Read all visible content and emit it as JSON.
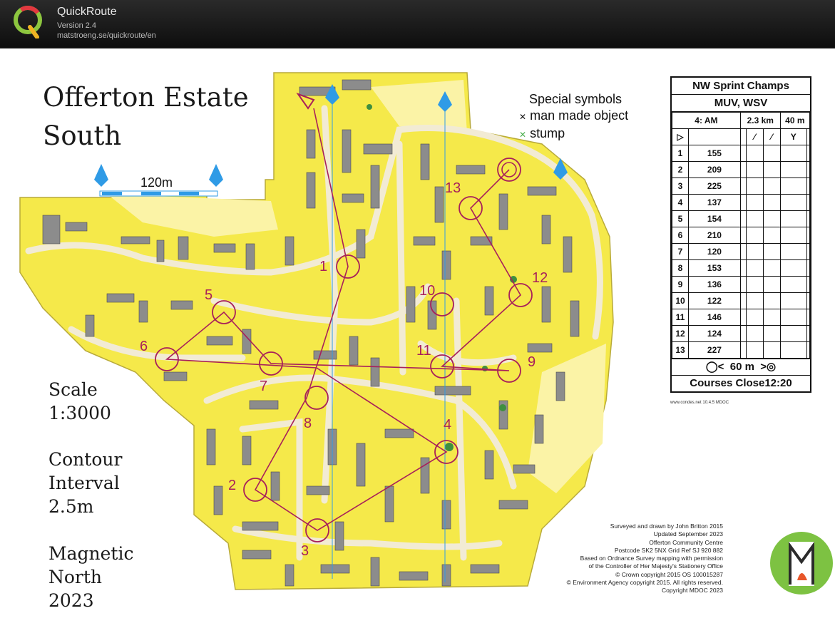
{
  "app": {
    "name": "QuickRoute",
    "version": "Version 2.4",
    "url": "matstroeng.se/quickroute/en"
  },
  "map": {
    "title_lines": [
      "Offerton Estate",
      "South"
    ],
    "scale_bar_label": "120m",
    "scale": [
      "Scale",
      "1:3000"
    ],
    "contour": [
      "Contour",
      "Interval",
      "2.5m"
    ],
    "magnetic": [
      "Magnetic",
      "North",
      "2023"
    ],
    "special_symbols": {
      "heading": "Special symbols",
      "items": [
        "man made object",
        "stump"
      ]
    },
    "control_numbers": [
      "1",
      "2",
      "3",
      "4",
      "5",
      "6",
      "7",
      "8",
      "9",
      "10",
      "11",
      "12",
      "13"
    ],
    "credits": [
      "Surveyed and drawn by John Britton 2015",
      "Updated September 2023",
      "Offerton Community Centre",
      "Postcode SK2 5NX   Grid Ref SJ 920 882",
      "Based on Ordnance Survey mapping with permission",
      "of the Controller of Her Majesty's Stationery Office",
      "© Crown copyright 2015 OS 100015287",
      "© Environment Agency copyright 2015. All rights reserved.",
      "Copyright MDOC 2023"
    ]
  },
  "control_description": {
    "event": "NW Sprint Champs",
    "classes": "MUV, WSV",
    "course": "4: AM",
    "length": "2.3 km",
    "climb": "40 m",
    "controls": [
      {
        "n": "1",
        "code": "155"
      },
      {
        "n": "2",
        "code": "209"
      },
      {
        "n": "3",
        "code": "225"
      },
      {
        "n": "4",
        "code": "137"
      },
      {
        "n": "5",
        "code": "154"
      },
      {
        "n": "6",
        "code": "210"
      },
      {
        "n": "7",
        "code": "120"
      },
      {
        "n": "8",
        "code": "153"
      },
      {
        "n": "9",
        "code": "136"
      },
      {
        "n": "10",
        "code": "122"
      },
      {
        "n": "11",
        "code": "146"
      },
      {
        "n": "12",
        "code": "124"
      },
      {
        "n": "13",
        "code": "227"
      }
    ],
    "finish_distance": "60 m",
    "closing": "Courses Close12:20",
    "source": "www.condes.net 10.4.5 MDOC"
  },
  "colors": {
    "open": "#f5e94a",
    "rough": "#fbf3a6",
    "building": "#8c8c8c",
    "route": "#a8205a",
    "magnetic": "#2f9be6"
  }
}
